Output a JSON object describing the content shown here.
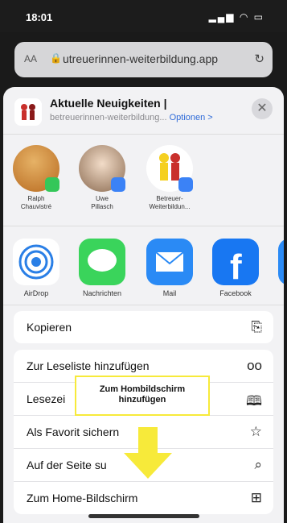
{
  "status": {
    "time": "18:01",
    "icons": "wifi-battery"
  },
  "address": {
    "aa": "AA",
    "url": "utreuerinnen-weiterbildung.app"
  },
  "sheet": {
    "title": "Aktuelle Neuigkeiten |",
    "subtitle": "betreuerinnen-weiterbildung...",
    "options": "Optionen >"
  },
  "people": [
    {
      "name": "Ralph\nChauvistré"
    },
    {
      "name": "Uwe\nPillasch"
    },
    {
      "name": "Betreuer-\nWeiterbildun..."
    }
  ],
  "apps": [
    {
      "name": "AirDrop"
    },
    {
      "name": "Nachrichten"
    },
    {
      "name": "Mail"
    },
    {
      "name": "Facebook"
    }
  ],
  "actions_group1": [
    {
      "label": "Kopieren",
      "icon": "copy-icon"
    }
  ],
  "actions_group2": [
    {
      "label": "Zur Leseliste hinzufügen",
      "icon": "glasses-icon"
    },
    {
      "label": "Lesezei",
      "icon": "book-icon"
    },
    {
      "label": "Als Favorit sichern",
      "icon": "star-icon"
    },
    {
      "label": "Auf der Seite su",
      "icon": "search-icon"
    },
    {
      "label": "Zum Home-Bildschirm",
      "icon": "add-square-icon"
    }
  ],
  "tooltip": {
    "text": "Zum Hombildschirm\nhinzufügen"
  },
  "colors": {
    "accent": "#2f6bd8",
    "highlight": "#f7ea3a"
  }
}
